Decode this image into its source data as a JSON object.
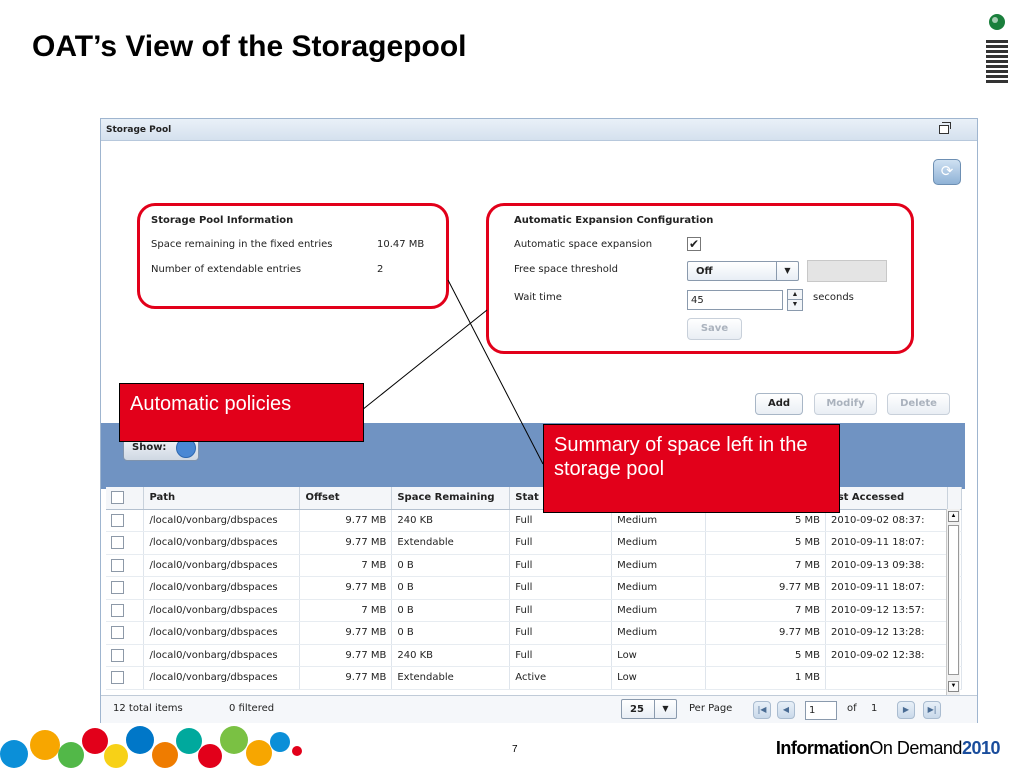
{
  "slide": {
    "title": "OAT’s View of the Storagepool",
    "page_number": "7",
    "brand": {
      "part1": "Information",
      "part2": "On Demand",
      "year": "2010"
    }
  },
  "window": {
    "title": "Storage Pool"
  },
  "pool_info": {
    "heading": "Storage Pool Information",
    "rows": [
      {
        "label": "Space remaining in the fixed entries",
        "value": "10.47 MB"
      },
      {
        "label": "Number of extendable entries",
        "value": "2"
      }
    ]
  },
  "auto_expansion": {
    "heading": "Automatic Expansion Configuration",
    "expansion_label": "Automatic space expansion",
    "threshold_label": "Free space threshold",
    "threshold_value": "Off",
    "wait_label": "Wait time",
    "wait_value": "45",
    "wait_unit": "seconds",
    "save_label": "Save"
  },
  "actions": {
    "add": "Add",
    "modify": "Modify",
    "delete": "Delete"
  },
  "show_label": "Show:",
  "callouts": {
    "policies": "Automatic policies",
    "summary": "Summary of space left in the storage pool"
  },
  "table": {
    "columns": [
      "Path",
      "Offset",
      "Space Remaining",
      "Stat",
      "",
      "",
      "ast Accessed"
    ],
    "rows": [
      [
        "/local0/vonbarg/dbspaces",
        "9.77 MB",
        "240 KB",
        "Full",
        "Medium",
        "5 MB",
        "2010-09-02 08:37:"
      ],
      [
        "/local0/vonbarg/dbspaces",
        "9.77 MB",
        "Extendable",
        "Full",
        "Medium",
        "5 MB",
        "2010-09-11 18:07:"
      ],
      [
        "/local0/vonbarg/dbspaces",
        "7 MB",
        "0 B",
        "Full",
        "Medium",
        "7 MB",
        "2010-09-13 09:38:"
      ],
      [
        "/local0/vonbarg/dbspaces",
        "9.77 MB",
        "0 B",
        "Full",
        "Medium",
        "9.77 MB",
        "2010-09-11 18:07:"
      ],
      [
        "/local0/vonbarg/dbspaces",
        "7 MB",
        "0 B",
        "Full",
        "Medium",
        "7 MB",
        "2010-09-12 13:57:"
      ],
      [
        "/local0/vonbarg/dbspaces",
        "9.77 MB",
        "0 B",
        "Full",
        "Medium",
        "9.77 MB",
        "2010-09-12 13:28:"
      ],
      [
        "/local0/vonbarg/dbspaces",
        "9.77 MB",
        "240 KB",
        "Full",
        "Low",
        "5 MB",
        "2010-09-02 12:38:"
      ],
      [
        "/local0/vonbarg/dbspaces",
        "9.77 MB",
        "Extendable",
        "Active",
        "Low",
        "1 MB",
        ""
      ]
    ]
  },
  "footer": {
    "total": "12 total items",
    "filtered": "0 filtered",
    "per_page_value": "25",
    "per_page_label": "Per Page",
    "page_value": "1",
    "of_label": "of",
    "total_pages": "1"
  },
  "colors": {
    "callout": "#e2001a",
    "band": "#7093c2"
  }
}
